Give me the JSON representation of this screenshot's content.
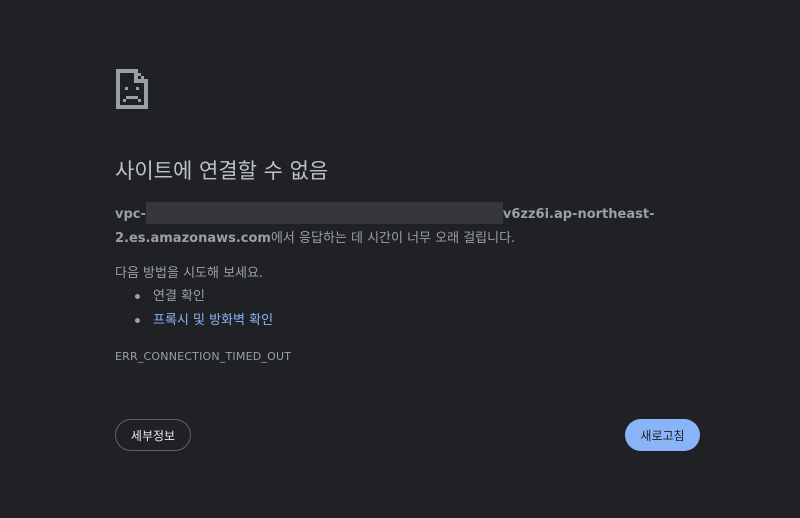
{
  "error_page": {
    "title": "사이트에 연결할 수 없음",
    "host_prefix": "vpc-",
    "host_suffix_line1": "v6zz6i.ap-northeast-",
    "host_suffix_line2": "2.es.amazonaws.com",
    "description_tail": "에서 응답하는 데 시간이 너무 오래 걸립니다.",
    "try_heading": "다음 방법을 시도해 보세요.",
    "suggestions": [
      {
        "label": "연결 확인",
        "is_link": false
      },
      {
        "label": "프록시 및 방화벽 확인",
        "is_link": true
      }
    ],
    "error_code": "ERR_CONNECTION_TIMED_OUT",
    "details_button": "세부정보",
    "reload_button": "새로고침"
  },
  "colors": {
    "background": "#202124",
    "text": "#9aa0a6",
    "title": "#bdc1c6",
    "link": "#8ab4f8",
    "primary_button": "#8ab4f8"
  },
  "icons": {
    "error": "sad-document-icon"
  }
}
